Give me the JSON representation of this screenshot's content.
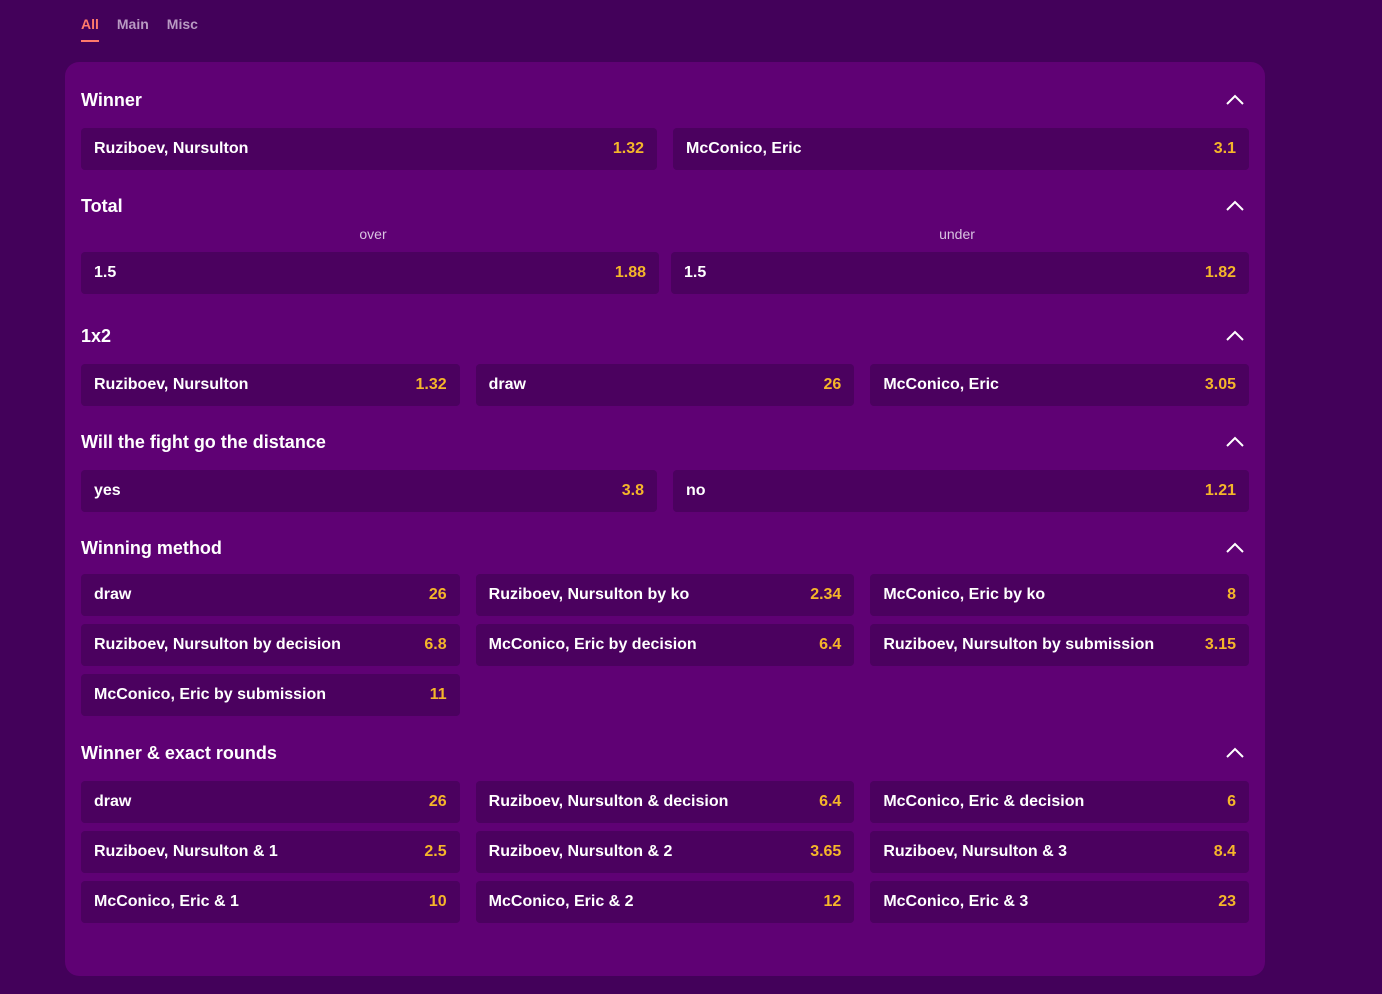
{
  "tabs": [
    {
      "label": "All",
      "active": true
    },
    {
      "label": "Main",
      "active": false
    },
    {
      "label": "Misc",
      "active": false
    }
  ],
  "colors": {
    "page_bg": "#43015a",
    "panel_bg": "#5f0174",
    "odd_bg": "#4b015f",
    "odd_value": "#f5b62a",
    "active_tab": "#ff7a6b"
  },
  "icons": {
    "collapse": "chevron-up-icon"
  },
  "markets": {
    "winner": {
      "title": "Winner",
      "odds": [
        {
          "label": "Ruziboev, Nursulton",
          "value": "1.32"
        },
        {
          "label": "McConico, Eric",
          "value": "3.1"
        }
      ]
    },
    "total": {
      "title": "Total",
      "subheads": [
        "over",
        "under"
      ],
      "odds": [
        {
          "label": "1.5",
          "value": "1.88"
        },
        {
          "label": "1.5",
          "value": "1.82"
        }
      ]
    },
    "one_x_two": {
      "title": "1x2",
      "odds": [
        {
          "label": "Ruziboev, Nursulton",
          "value": "1.32"
        },
        {
          "label": "draw",
          "value": "26"
        },
        {
          "label": "McConico, Eric",
          "value": "3.05"
        }
      ]
    },
    "distance": {
      "title": "Will the fight go the distance",
      "odds": [
        {
          "label": "yes",
          "value": "3.8"
        },
        {
          "label": "no",
          "value": "1.21"
        }
      ]
    },
    "method": {
      "title": "Winning method",
      "odds": [
        {
          "label": "draw",
          "value": "26"
        },
        {
          "label": "Ruziboev, Nursulton by ko",
          "value": "2.34"
        },
        {
          "label": "McConico, Eric by ko",
          "value": "8"
        },
        {
          "label": "Ruziboev, Nursulton by decision",
          "value": "6.8"
        },
        {
          "label": "McConico, Eric by decision",
          "value": "6.4"
        },
        {
          "label": "Ruziboev, Nursulton by submission",
          "value": "3.15"
        },
        {
          "label": "McConico, Eric by submission",
          "value": "11"
        }
      ]
    },
    "rounds": {
      "title": "Winner & exact rounds",
      "odds": [
        {
          "label": "draw",
          "value": "26"
        },
        {
          "label": "Ruziboev, Nursulton & decision",
          "value": "6.4"
        },
        {
          "label": "McConico, Eric & decision",
          "value": "6"
        },
        {
          "label": "Ruziboev, Nursulton & 1",
          "value": "2.5"
        },
        {
          "label": "Ruziboev, Nursulton & 2",
          "value": "3.65"
        },
        {
          "label": "Ruziboev, Nursulton & 3",
          "value": "8.4"
        },
        {
          "label": "McConico, Eric & 1",
          "value": "10"
        },
        {
          "label": "McConico, Eric & 2",
          "value": "12"
        },
        {
          "label": "McConico, Eric & 3",
          "value": "23"
        }
      ]
    }
  }
}
